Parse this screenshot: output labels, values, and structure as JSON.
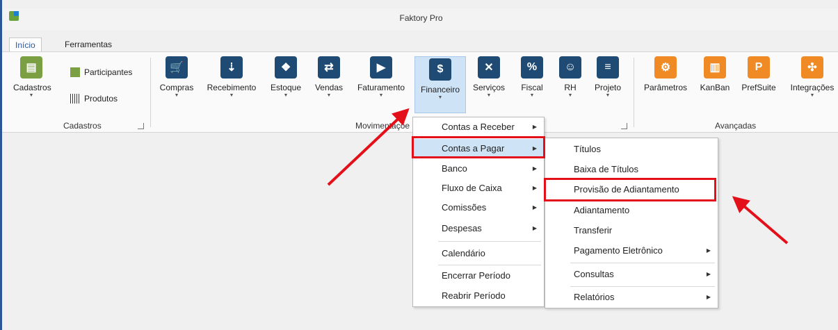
{
  "window": {
    "title": "Faktory Pro"
  },
  "tabs": [
    {
      "label": "Início"
    },
    {
      "label": "Ferramentas"
    }
  ],
  "ribbon": {
    "cadastros": {
      "main": "Cadastros",
      "participantes": "Participantes",
      "produtos": "Produtos",
      "group": "Cadastros"
    },
    "movimentacao": {
      "buttons": [
        "Compras",
        "Recebimento",
        "Estoque",
        "Vendas",
        "Faturamento",
        "Financeiro",
        "Serviços",
        "Fiscal",
        "RH",
        "Projeto"
      ],
      "group": "Movimentaçõe"
    },
    "avancadas": {
      "buttons": [
        "Parâmetros",
        "KanBan",
        "PrefSuite",
        "Integrações"
      ],
      "group": "Avançadas"
    }
  },
  "financeiro_menu": {
    "items": [
      "Contas a Receber",
      "Contas a Pagar",
      "Banco",
      "Fluxo de Caixa",
      "Comissões",
      "Despesas",
      "Calendário",
      "Encerrar Período",
      "Reabrir Período"
    ]
  },
  "pagar_menu": {
    "items": [
      "Títulos",
      "Baixa de Títulos",
      "Provisão de Adiantamento",
      "Adiantamento",
      "Transferir",
      "Pagamento Eletrônico",
      "Consultas",
      "Relatórios"
    ]
  },
  "colors": {
    "accent": "#2b579a",
    "highlight": "#cfe3f7",
    "annotation": "#e3101a"
  }
}
